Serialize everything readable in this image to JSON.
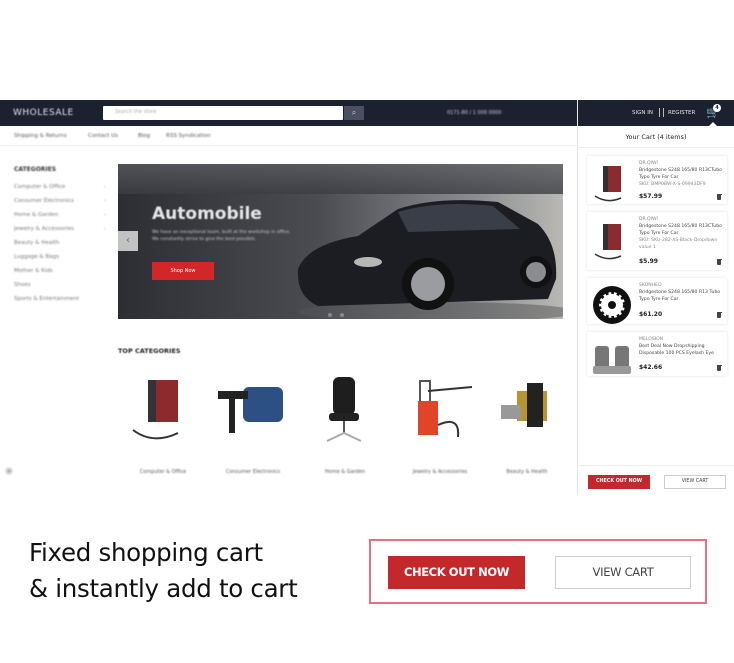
{
  "header": {
    "logo_prefix": "W",
    "logo_text": "WHOLESALE",
    "search_placeholder": "Search the store",
    "phone": "0171-80 / 1 000 0000",
    "signin": "SIGN IN",
    "register": "REGISTER",
    "cart_count": "4"
  },
  "nav": {
    "items": [
      "Shipping & Returns",
      "Contact Us",
      "Blog",
      "RSS Syndication"
    ]
  },
  "categories": {
    "title": "CATEGORIES",
    "items": [
      {
        "label": "Computer & Office",
        "arrow": "›"
      },
      {
        "label": "Consumer Electronics",
        "arrow": "›"
      },
      {
        "label": "Home & Garden",
        "arrow": "›"
      },
      {
        "label": "Jewelry & Accessories",
        "arrow": "›"
      },
      {
        "label": "Beauty & Health",
        "arrow": ""
      },
      {
        "label": "Luggage & Bags",
        "arrow": ""
      },
      {
        "label": "Mother & Kids",
        "arrow": ""
      },
      {
        "label": "Shoes",
        "arrow": ""
      },
      {
        "label": "Sports & Entertainment",
        "arrow": ""
      }
    ]
  },
  "hero": {
    "title": "Automobile",
    "description": "We have an exceptional team, built at the workshop in office. We constantly strive to give the best possible.",
    "button": "Shop Now",
    "prev_icon": "‹"
  },
  "top_categories": {
    "title": "TOP CATEGORIES",
    "items": [
      {
        "label": "Computer & Office"
      },
      {
        "label": "Consumer Electronics"
      },
      {
        "label": "Home & Garden"
      },
      {
        "label": "Jewelry & Accessories"
      },
      {
        "label": "Beauty & Health"
      }
    ]
  },
  "cart": {
    "title": "Your Cart (4 items)",
    "items": [
      {
        "brand": "DR.QIWI",
        "name": "Bridgestone S248 165/80 R13CTubo Typo Tyre For Car",
        "sku": "SKU: BMP0BW-X-S-09943DF9",
        "price": "$57.99"
      },
      {
        "brand": "DR.QIWI",
        "name": "Bridgestone S248 165/80 R13CTubo Typo Tyre For Car",
        "sku": "SKU: SKU-282-XS-Black-Dropdown value 1",
        "price": "$5.99"
      },
      {
        "brand": "SKONHED",
        "name": "Bridgestone S248 165/80 R13 Tubo Typo Tyre For Car",
        "sku": "",
        "price": "$61.20"
      },
      {
        "brand": "MELOSION",
        "name": "Best Deal Now Dropshipping Disposable 100 PCS Eyelash Eye",
        "sku": "",
        "price": "$42.66"
      }
    ],
    "checkout": "CHECK OUT NOW",
    "view": "VIEW CART"
  },
  "promo": {
    "line1": "Fixed shopping cart",
    "line2": "& instantly add to cart",
    "checkout": "CHECK OUT NOW",
    "view": "VIEW CART"
  },
  "colors": {
    "topbar": "#1c2130",
    "accent_red": "#c3282b",
    "callout_border": "#e8707c"
  }
}
